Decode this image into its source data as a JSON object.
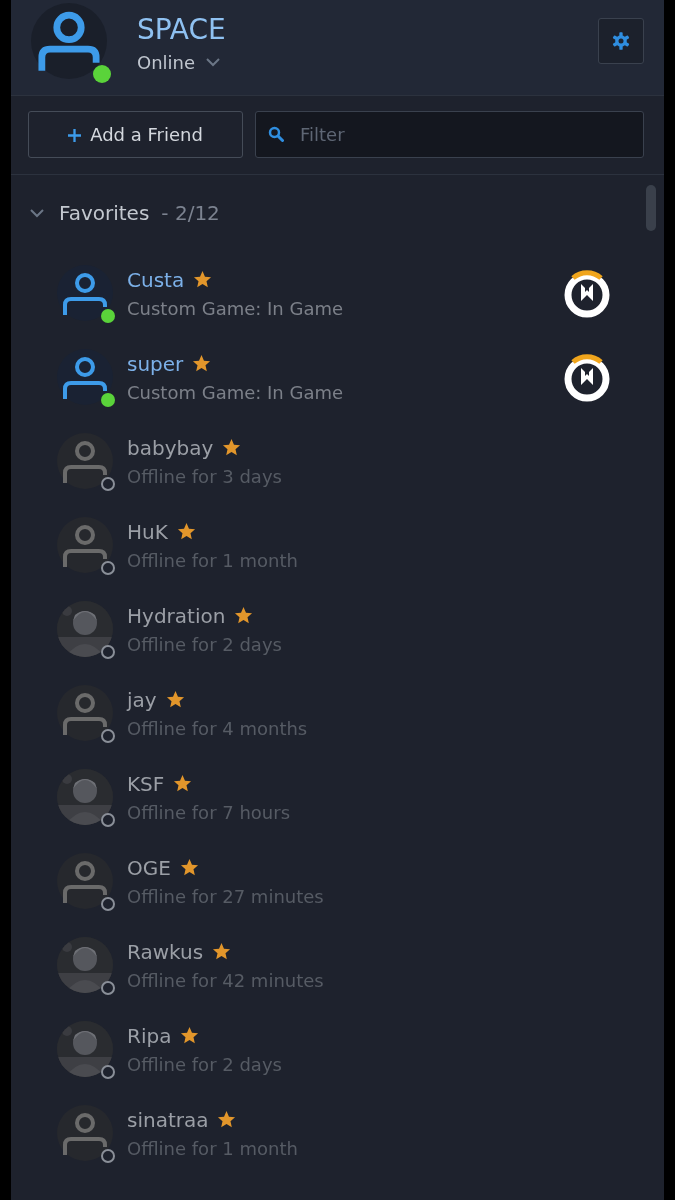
{
  "profile": {
    "name": "SPACE",
    "status": "Online",
    "online": true
  },
  "actions": {
    "add_button": "Add a Friend",
    "filter": {
      "placeholder": "Filter"
    }
  },
  "group": {
    "title": "Favorites",
    "count": "- 2/12",
    "expanded": true
  },
  "friends": [
    {
      "name": "Custa",
      "status": "Custom Game: In Game",
      "online": true,
      "favorite": true,
      "avatar": {
        "kind": "default"
      },
      "game": {
        "kind": "overwatch"
      }
    },
    {
      "name": "super",
      "status": "Custom Game: In Game",
      "online": true,
      "favorite": true,
      "avatar": {
        "kind": "default"
      },
      "game": {
        "kind": "overwatch"
      }
    },
    {
      "name": "babybay",
      "status": "Offline for 3 days",
      "online": false,
      "favorite": true,
      "avatar": {
        "kind": "default"
      }
    },
    {
      "name": "HuK",
      "status": "Offline for 1 month",
      "online": false,
      "favorite": true,
      "avatar": {
        "kind": "default"
      }
    },
    {
      "name": "Hydration",
      "status": "Offline for 2 days",
      "online": false,
      "favorite": true
    },
    {
      "name": "jay",
      "status": "Offline for 4 months",
      "online": false,
      "favorite": true,
      "avatar": {
        "kind": "default"
      }
    },
    {
      "name": "KSF",
      "status": "Offline for 7 hours",
      "online": false,
      "favorite": true
    },
    {
      "name": "OGE",
      "status": "Offline for 27 minutes",
      "online": false,
      "favorite": true,
      "avatar": {
        "kind": "default"
      }
    },
    {
      "name": "Rawkus",
      "status": "Offline for 42 minutes",
      "online": false,
      "favorite": true
    },
    {
      "name": "Ripa",
      "status": "Offline for 2 days",
      "online": false,
      "favorite": true
    },
    {
      "name": "sinatraa",
      "status": "Offline for 1 month",
      "online": false,
      "favorite": true,
      "avatar": {
        "kind": "default"
      }
    }
  ]
}
